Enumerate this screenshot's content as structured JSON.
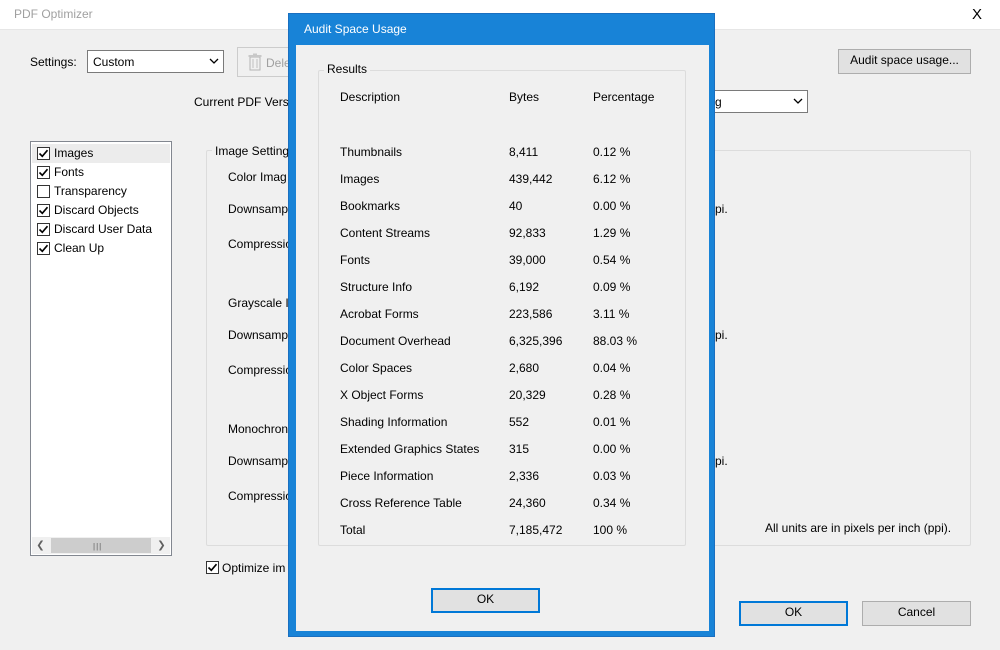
{
  "window": {
    "title": "PDF Optimizer",
    "close_symbol": "X"
  },
  "settings": {
    "label": "Settings:",
    "value": "Custom",
    "delete_label": "Dele",
    "audit_button": "Audit space usage...",
    "current_version_label": "Current PDF Versi",
    "compat_value": "g"
  },
  "sidebar": {
    "items": [
      {
        "label": "Images",
        "checked": true
      },
      {
        "label": "Fonts",
        "checked": true
      },
      {
        "label": "Transparency",
        "checked": false
      },
      {
        "label": "Discard Objects",
        "checked": true
      },
      {
        "label": "Discard User Data",
        "checked": true
      },
      {
        "label": "Clean Up",
        "checked": true
      }
    ]
  },
  "image_settings": {
    "group_title": "Image Setting",
    "color_label": "Color Imag",
    "downsample1": "Downsamp",
    "ppi1": "pi.",
    "compression1": "Compressio",
    "grayscale_label": "Grayscale I",
    "downsample2": "Downsamp",
    "ppi2": "pi.",
    "compression2": "Compressio",
    "mono_label": "Monochron",
    "downsample3": "Downsamp",
    "ppi3": "pi.",
    "compression3": "Compressio",
    "units_note": "All units are in pixels per inch (ppi)."
  },
  "optimize": {
    "label": "Optimize im",
    "checked": true
  },
  "footer": {
    "ok": "OK",
    "cancel": "Cancel"
  },
  "dialog": {
    "title": "Audit Space Usage",
    "results_title": "Results",
    "headers": {
      "description": "Description",
      "bytes": "Bytes",
      "percentage": "Percentage"
    },
    "rows": [
      {
        "description": "Thumbnails",
        "bytes": "8,411",
        "percentage": "0.12 %"
      },
      {
        "description": "Images",
        "bytes": "439,442",
        "percentage": "6.12 %"
      },
      {
        "description": "Bookmarks",
        "bytes": "40",
        "percentage": "0.00 %"
      },
      {
        "description": "Content Streams",
        "bytes": "92,833",
        "percentage": "1.29 %"
      },
      {
        "description": "Fonts",
        "bytes": "39,000",
        "percentage": "0.54 %"
      },
      {
        "description": "Structure Info",
        "bytes": "6,192",
        "percentage": "0.09 %"
      },
      {
        "description": "Acrobat Forms",
        "bytes": "223,586",
        "percentage": "3.11 %"
      },
      {
        "description": "Document Overhead",
        "bytes": "6,325,396",
        "percentage": "88.03 %"
      },
      {
        "description": "Color Spaces",
        "bytes": "2,680",
        "percentage": "0.04 %"
      },
      {
        "description": "X Object Forms",
        "bytes": "20,329",
        "percentage": "0.28 %"
      },
      {
        "description": "Shading Information",
        "bytes": "552",
        "percentage": "0.01 %"
      },
      {
        "description": "Extended Graphics States",
        "bytes": "315",
        "percentage": "0.00 %"
      },
      {
        "description": "Piece Information",
        "bytes": "2,336",
        "percentage": "0.03 %"
      },
      {
        "description": "Cross Reference Table",
        "bytes": "24,360",
        "percentage": "0.34 %"
      },
      {
        "description": "Total",
        "bytes": "7,185,472",
        "percentage": "100 %"
      }
    ],
    "ok": "OK"
  },
  "colors": {
    "dialog_frame": "#1883d7",
    "focus_border": "#0078d7",
    "window_bg": "#f0f0f0"
  }
}
